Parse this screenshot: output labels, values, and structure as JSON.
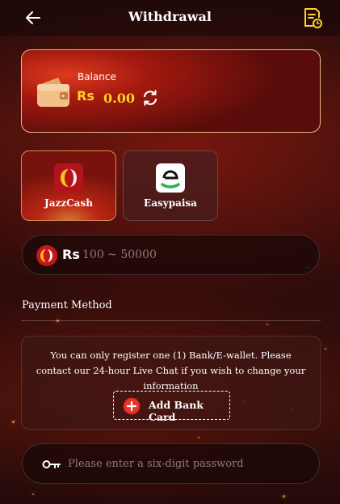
{
  "header": {
    "title": "Withdrawal"
  },
  "balance": {
    "label": "Balance",
    "currency": "Rs",
    "amount": "0.00"
  },
  "methods": [
    {
      "label": "JazzCash"
    },
    {
      "label": "Easypaisa"
    }
  ],
  "amount_field": {
    "currency": "Rs",
    "placeholder": "100 ~ 50000"
  },
  "payment": {
    "title": "Payment Method",
    "notice": "You can only register one (1) Bank/E-wallet. Please contact our 24-hour Live Chat if you wish to change your information",
    "add_label": "Add Bank Card"
  },
  "password_field": {
    "placeholder": "Please enter a six-digit password"
  },
  "colors": {
    "accent": "#ffd21f",
    "card_border": "#e7b98a",
    "background": "#2a0d0b"
  }
}
